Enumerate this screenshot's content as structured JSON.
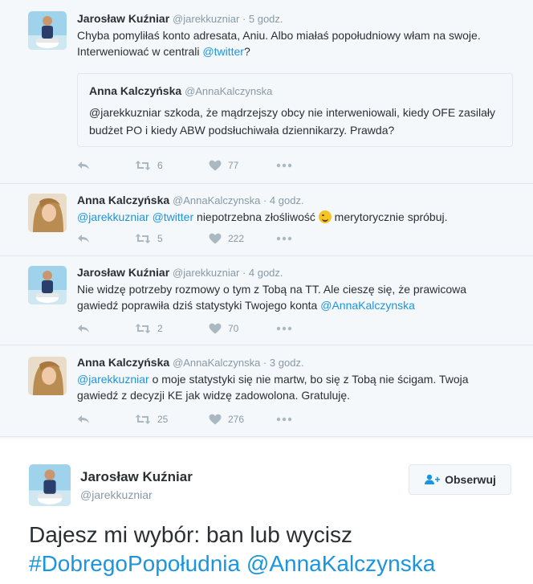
{
  "tweets": [
    {
      "name": "Jarosław Kuźniar",
      "meta": "@jarekkuzniar · 5 godz.",
      "text_parts": [
        "Chyba pomyliłaś konto adresata, Aniu. Albo miałaś popołudniowy włam na swoje. Interweniować w centrali ",
        "@twitter",
        "?"
      ],
      "quote": {
        "name": "Anna Kalczyńska",
        "handle": "@AnnaKalczynska",
        "text": "@jarekkuzniar szkoda, że mądrzejszy obcy nie interweniowali, kiedy OFE zasilały budżet PO i kiedy ABW podsłuchiwała dziennikarzy. Prawda?"
      },
      "retweets": "6",
      "likes": "77"
    },
    {
      "name": "Anna Kalczyńska",
      "meta": "@AnnaKalczynska · 4 godz.",
      "mention1": "@jarekkuzniar",
      "mention2": "@twitter",
      "text_a": " niepotrzebna złośliwość ",
      "text_b": " merytorycznie spróbuj.",
      "retweets": "5",
      "likes": "222"
    },
    {
      "name": "Jarosław Kuźniar",
      "meta": "@jarekkuzniar · 4 godz.",
      "text": "Nie widzę potrzeby rozmowy o tym z Tobą na TT. Ale cieszę się, że prawicowa gawiedź poprawiła dziś statystyki Twojego konta ",
      "mention": "@AnnaKalczynska",
      "retweets": "2",
      "likes": "70"
    },
    {
      "name": "Anna Kalczyńska",
      "meta": "@AnnaKalczynska · 3 godz.",
      "mention": "@jarekkuzniar",
      "text": " o moje statystyki się nie martw, bo się z Tobą nie ścigam. Twoja gawiedź z decyzji KE jak widzę  zadowolona. Gratuluję.",
      "retweets": "25",
      "likes": "276"
    }
  ],
  "main_tweet": {
    "name": "Jarosław Kuźniar",
    "handle": "@jarekkuzniar",
    "follow_label": "Obserwuj",
    "text": "Dajesz mi wybór: ban lub wycisz",
    "hashtag": "#DobregoPopołudnia",
    "mention": "@AnnaKalczynska"
  },
  "icons": {
    "reply": "reply-icon",
    "retweet": "retweet-icon",
    "like": "heart-icon",
    "more": "more-icon",
    "follow": "follow-user-icon",
    "emoji": "wink-emoji-icon"
  },
  "colors": {
    "link": "#1b95e0",
    "icon": "#aab8c2",
    "muted": "#8899a6",
    "background": "#f5f8fa"
  }
}
